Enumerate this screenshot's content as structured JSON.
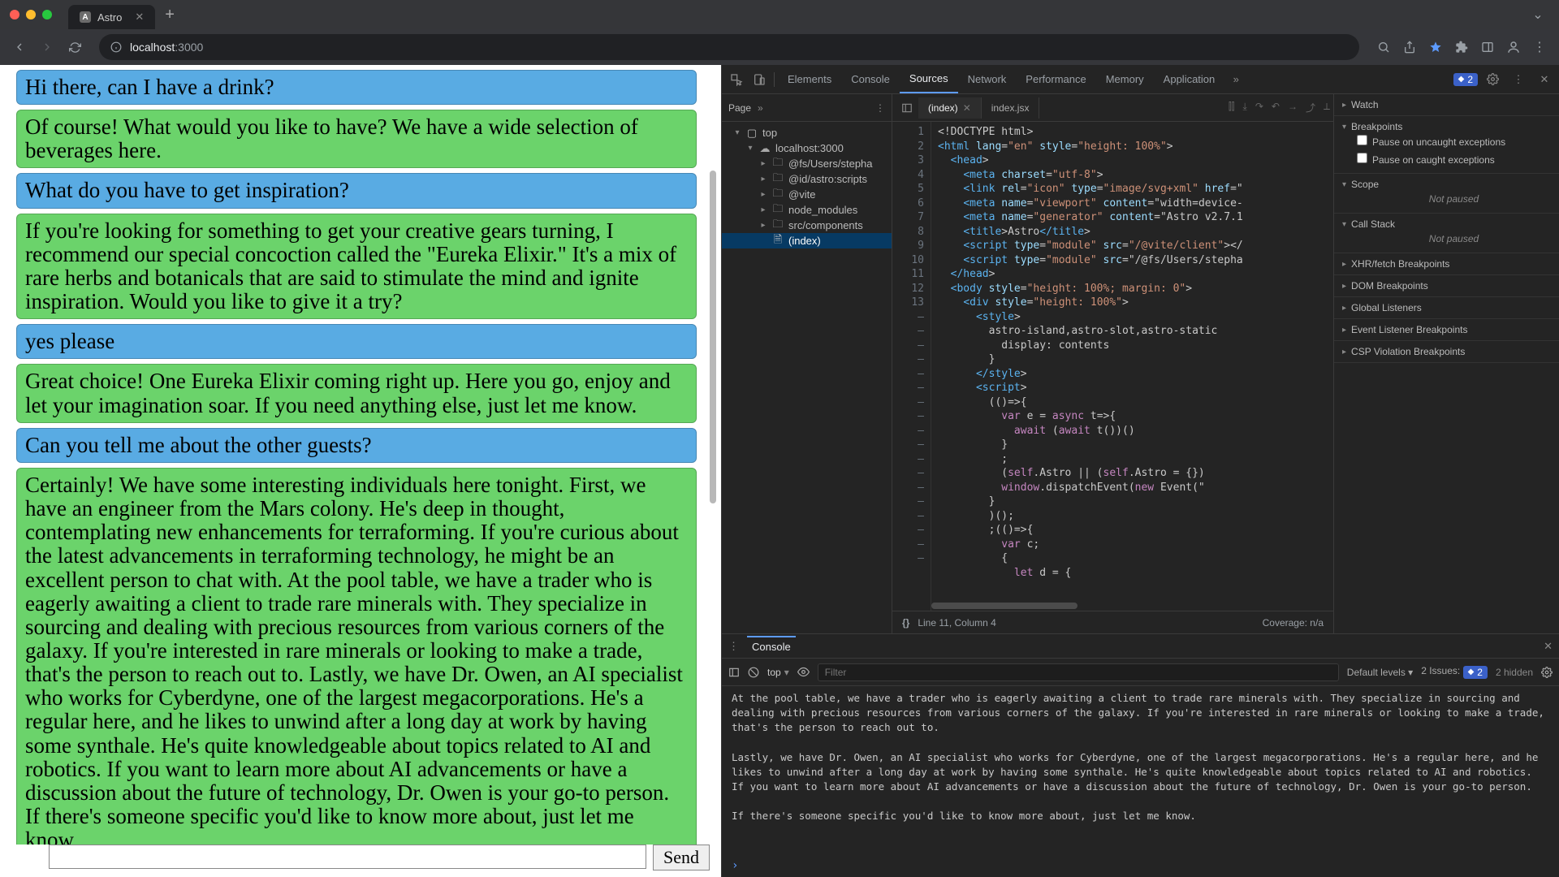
{
  "browser": {
    "tab_title": "Astro",
    "url_host": "localhost",
    "url_port": ":3000"
  },
  "chat": {
    "messages": [
      {
        "role": "user",
        "text": "Hi there, can I have a drink?"
      },
      {
        "role": "ai",
        "text": "Of course! What would you like to have? We have a wide selection of beverages here."
      },
      {
        "role": "user",
        "text": "What do you have to get inspiration?"
      },
      {
        "role": "ai",
        "text": "If you're looking for something to get your creative gears turning, I recommend our special concoction called the \"Eureka Elixir.\" It's a mix of rare herbs and botanicals that are said to stimulate the mind and ignite inspiration. Would you like to give it a try?"
      },
      {
        "role": "user",
        "text": "yes please"
      },
      {
        "role": "ai",
        "text": "Great choice! One Eureka Elixir coming right up. Here you go, enjoy and let your imagination soar. If you need anything else, just let me know."
      },
      {
        "role": "user",
        "text": "Can you tell me about the other guests?"
      },
      {
        "role": "ai",
        "text": "Certainly! We have some interesting individuals here tonight. First, we have an engineer from the Mars colony. He's deep in thought, contemplating new enhancements for terraforming. If you're curious about the latest advancements in terraforming technology, he might be an excellent person to chat with. At the pool table, we have a trader who is eagerly awaiting a client to trade rare minerals with. They specialize in sourcing and dealing with precious resources from various corners of the galaxy. If you're interested in rare minerals or looking to make a trade, that's the person to reach out to. Lastly, we have Dr. Owen, an AI specialist who works for Cyberdyne, one of the largest megacorporations. He's a regular here, and he likes to unwind after a long day at work by having some synthale. He's quite knowledgeable about topics related to AI and robotics. If you want to learn more about AI advancements or have a discussion about the future of technology, Dr. Owen is your go-to person. If there's someone specific you'd like to know more about, just let me know."
      }
    ],
    "send_label": "Send",
    "input_value": ""
  },
  "devtools": {
    "tabs": [
      "Elements",
      "Console",
      "Sources",
      "Network",
      "Performance",
      "Memory",
      "Application"
    ],
    "active_tab": "Sources",
    "issues_count": "2",
    "files_head": "Page",
    "tree": {
      "top": "top",
      "host": "localhost:3000",
      "children": [
        "@fs/Users/stepha",
        "@id/astro:scripts",
        "@vite",
        "node_modules",
        "src/components"
      ],
      "file_index": "(index)"
    },
    "editor_tabs": [
      {
        "name": "(index)",
        "active": true
      },
      {
        "name": "index.jsx",
        "active": false
      }
    ],
    "gutter": [
      "1",
      "2",
      "3",
      "4",
      "5",
      "6",
      "7",
      "8",
      "9",
      "10",
      "11",
      "12",
      "13",
      "–",
      "–",
      "–",
      "–",
      "–",
      "–",
      "–",
      "–",
      "–",
      "–",
      "–",
      "–",
      "–",
      "–",
      "–",
      "–",
      "–",
      "–"
    ],
    "code_lines": [
      "<!DOCTYPE html>",
      "<html lang=\"en\" style=\"height: 100%\">",
      "  <head>",
      "    <meta charset=\"utf-8\">",
      "    <link rel=\"icon\" type=\"image/svg+xml\" href=\"",
      "    <meta name=\"viewport\" content=\"width=device-",
      "    <meta name=\"generator\" content=\"Astro v2.7.1",
      "    <title>Astro</title>",
      "    <script type=\"module\" src=\"/@vite/client\"></",
      "    <script type=\"module\" src=\"/@fs/Users/stepha",
      "  </head>",
      "  <body style=\"height: 100%; margin: 0\">",
      "    <div style=\"height: 100%\">",
      "      <style>",
      "        astro-island,astro-slot,astro-static",
      "          display: contents",
      "        }",
      "      </style>",
      "      <script>",
      "        (()=>{",
      "          var e = async t=>{",
      "            await (await t())()",
      "          }",
      "          ;",
      "          (self.Astro || (self.Astro = {})",
      "          window.dispatchEvent(new Event(\"",
      "        }",
      "        )();",
      "        ;(()=>{",
      "          var c;",
      "          {",
      "            let d = {"
    ],
    "status": {
      "pos": "Line 11, Column 4",
      "coverage": "Coverage: n/a"
    },
    "side": {
      "watch": "Watch",
      "bp": "Breakpoints",
      "bp_opts": [
        "Pause on uncaught exceptions",
        "Pause on caught exceptions"
      ],
      "scope": "Scope",
      "not_paused": "Not paused",
      "call": "Call Stack",
      "xhr": "XHR/fetch Breakpoints",
      "dom": "DOM Breakpoints",
      "gl": "Global Listeners",
      "el": "Event Listener Breakpoints",
      "csp": "CSP Violation Breakpoints"
    },
    "drawer": {
      "title": "Console",
      "context": "top",
      "filter_ph": "Filter",
      "levels": "Default levels",
      "issues_label": "2 Issues:",
      "issues_count": "2",
      "hidden": "2 hidden",
      "log_lines": [
        "At the pool table, we have a trader who is eagerly awaiting a client to trade rare minerals with. They specialize in sourcing and dealing with precious resources from various corners of the galaxy. If you're interested in rare minerals or looking to make a trade, that's the person to reach out to.",
        "",
        "Lastly, we have Dr. Owen, an AI specialist who works for Cyberdyne, one of the largest megacorporations. He's a regular here, and he likes to unwind after a long day at work by having some synthale. He's quite knowledgeable about topics related to AI and robotics. If you want to learn more about AI advancements or have a discussion about the future of technology, Dr. Owen is your go-to person.",
        "",
        "If there's someone specific you'd like to know more about, just let me know."
      ]
    }
  }
}
